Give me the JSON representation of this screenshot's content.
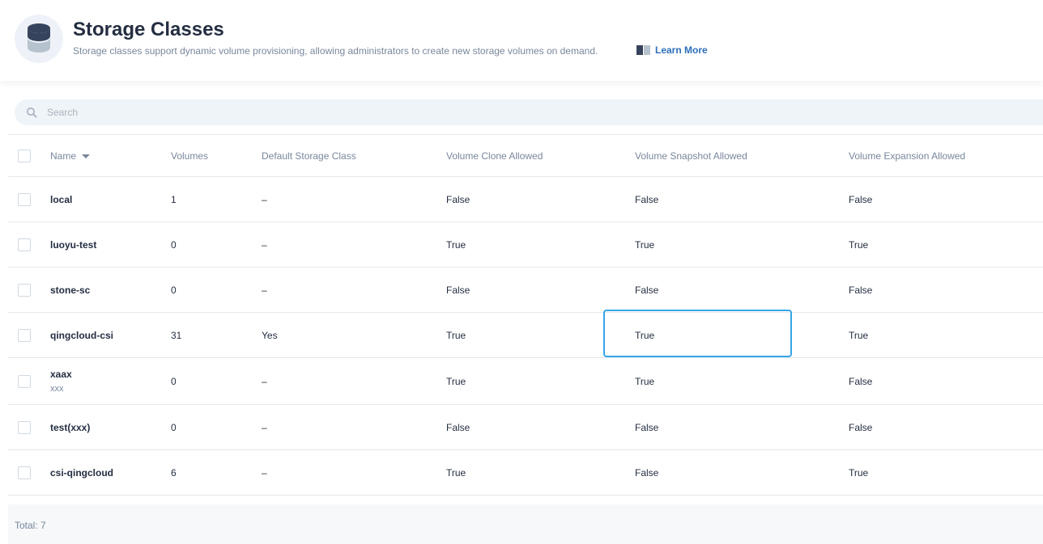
{
  "header": {
    "title": "Storage Classes",
    "description": "Storage classes support dynamic volume provisioning, allowing administrators to create new storage volumes on demand.",
    "learn_more": "Learn More",
    "icon": "storage-database-icon"
  },
  "search": {
    "placeholder": "Search"
  },
  "table": {
    "columns": {
      "name": "Name",
      "volumes": "Volumes",
      "default": "Default Storage Class",
      "clone": "Volume Clone Allowed",
      "snapshot": "Volume Snapshot Allowed",
      "expansion": "Volume Expansion Allowed"
    },
    "rows": [
      {
        "name": "local",
        "desc": "",
        "volumes": "1",
        "default": "–",
        "clone": "False",
        "snapshot": "False",
        "expansion": "False"
      },
      {
        "name": "luoyu-test",
        "desc": "",
        "volumes": "0",
        "default": "–",
        "clone": "True",
        "snapshot": "True",
        "expansion": "True"
      },
      {
        "name": "stone-sc",
        "desc": "",
        "volumes": "0",
        "default": "–",
        "clone": "False",
        "snapshot": "False",
        "expansion": "False"
      },
      {
        "name": "qingcloud-csi",
        "desc": "",
        "volumes": "31",
        "default": "Yes",
        "clone": "True",
        "snapshot": "True",
        "expansion": "True"
      },
      {
        "name": "xaax",
        "desc": "xxx",
        "volumes": "0",
        "default": "–",
        "clone": "True",
        "snapshot": "True",
        "expansion": "False"
      },
      {
        "name": "test(xxx)",
        "desc": "",
        "volumes": "0",
        "default": "–",
        "clone": "False",
        "snapshot": "False",
        "expansion": "False"
      },
      {
        "name": "csi-qingcloud",
        "desc": "",
        "volumes": "6",
        "default": "–",
        "clone": "True",
        "snapshot": "False",
        "expansion": "True"
      }
    ]
  },
  "footer": {
    "total": "Total: 7"
  },
  "colors": {
    "highlight": "#36a6e8",
    "link": "#2d6fb8",
    "text": "#242e42",
    "muted": "#79879c"
  }
}
